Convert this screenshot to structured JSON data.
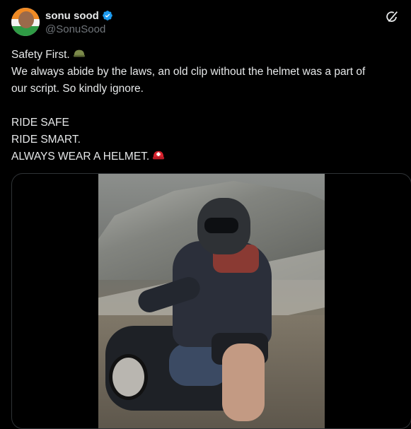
{
  "author": {
    "name": "sonu sood",
    "handle": "@SonuSood",
    "verified_color": "#1d9bf0"
  },
  "icons": {
    "verified": "verified-badge-icon",
    "grok": "grok-icon",
    "emoji_1": "military-helmet-emoji",
    "emoji_2": "rescue-worker-helmet-emoji"
  },
  "tweet": {
    "line1": "Safety First.",
    "line2": "We always abide by the laws, an old clip without the helmet was a part of",
    "line3": "our script. So kindly ignore.",
    "line4": "RIDE SAFE",
    "line5": "RIDE SMART.",
    "line6": "ALWAYS WEAR A HELMET."
  },
  "media": {
    "type": "video",
    "content": "Rider in a dark helmet on a motorcycle on a mountain road"
  }
}
